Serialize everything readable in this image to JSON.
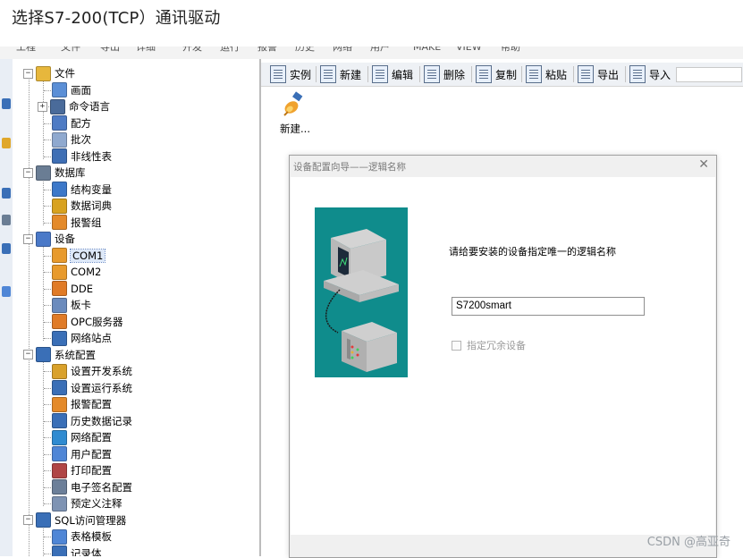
{
  "heading": "选择S7-200(TCP）通讯驱动",
  "menubar": {
    "items": [
      "工程",
      "文件",
      "导出",
      "详细",
      "开发",
      "运行",
      "报警",
      "历史",
      "网络",
      "用户",
      "MAKE",
      "VIEW",
      "帮助"
    ]
  },
  "tree": {
    "items": [
      {
        "label": "文件",
        "level": 0,
        "expander": "−",
        "icon": "folder-icon",
        "color": "#e7b73c"
      },
      {
        "label": "画面",
        "level": 1,
        "icon": "screen-icon",
        "color": "#5b8fd6"
      },
      {
        "label": "命令语言",
        "level": 1,
        "expander": "+",
        "icon": "command-icon",
        "color": "#4a6b9a"
      },
      {
        "label": "配方",
        "level": 1,
        "icon": "recipe-icon",
        "color": "#4e7bc4"
      },
      {
        "label": "批次",
        "level": 1,
        "icon": "batch-icon",
        "color": "#8fa9cf"
      },
      {
        "label": "非线性表",
        "level": 1,
        "icon": "nonlinear-table-icon",
        "color": "#3f6fb5"
      },
      {
        "label": "数据库",
        "level": 0,
        "expander": "−",
        "icon": "database-icon",
        "color": "#6a7d94"
      },
      {
        "label": "结构变量",
        "level": 1,
        "icon": "struct-variable-icon",
        "color": "#3c78c9"
      },
      {
        "label": "数据词典",
        "level": 1,
        "icon": "data-dictionary-icon",
        "color": "#d8a21f"
      },
      {
        "label": "报警组",
        "level": 1,
        "icon": "alarm-group-icon",
        "color": "#e48a2a"
      },
      {
        "label": "设备",
        "level": 0,
        "expander": "−",
        "icon": "device-icon",
        "color": "#4a79c8"
      },
      {
        "label": "COM1",
        "level": 1,
        "icon": "com-port-icon",
        "color": "#e89a2c",
        "selected": true
      },
      {
        "label": "COM2",
        "level": 1,
        "icon": "com-port-icon",
        "color": "#e89a2c"
      },
      {
        "label": "DDE",
        "level": 1,
        "icon": "dde-icon",
        "color": "#e07b27"
      },
      {
        "label": "板卡",
        "level": 1,
        "icon": "board-card-icon",
        "color": "#6b8bbd"
      },
      {
        "label": "OPC服务器",
        "level": 1,
        "icon": "opc-server-icon",
        "color": "#e07b27"
      },
      {
        "label": "网络站点",
        "level": 1,
        "icon": "network-node-icon",
        "color": "#3a6fb7"
      },
      {
        "label": "系统配置",
        "level": 0,
        "expander": "−",
        "icon": "system-config-icon",
        "color": "#3a6fb7"
      },
      {
        "label": "设置开发系统",
        "level": 1,
        "icon": "dev-system-icon",
        "color": "#d9a12b"
      },
      {
        "label": "设置运行系统",
        "level": 1,
        "icon": "run-system-icon",
        "color": "#3a6fb7"
      },
      {
        "label": "报警配置",
        "level": 1,
        "icon": "alarm-config-icon",
        "color": "#e48a2a"
      },
      {
        "label": "历史数据记录",
        "level": 1,
        "icon": "history-record-icon",
        "color": "#3a6fb7"
      },
      {
        "label": "网络配置",
        "level": 1,
        "icon": "network-config-icon",
        "color": "#2f8bd1"
      },
      {
        "label": "用户配置",
        "level": 1,
        "icon": "user-config-icon",
        "color": "#4f86d6"
      },
      {
        "label": "打印配置",
        "level": 1,
        "icon": "print-config-icon",
        "color": "#b04545"
      },
      {
        "label": "电子签名配置",
        "level": 1,
        "icon": "e-signature-icon",
        "color": "#6c7f99"
      },
      {
        "label": "预定义注释",
        "level": 1,
        "icon": "predefined-note-icon",
        "color": "#7e93b3"
      },
      {
        "label": "SQL访问管理器",
        "level": 0,
        "expander": "−",
        "icon": "sql-manager-icon",
        "color": "#3a6fb7"
      },
      {
        "label": "表格模板",
        "level": 1,
        "icon": "table-template-icon",
        "color": "#4f86d6"
      },
      {
        "label": "记录体",
        "level": 1,
        "icon": "record-icon",
        "color": "#3a6fb7"
      }
    ]
  },
  "toolbar": {
    "buttons": [
      {
        "label": "实例",
        "icon": "instance-icon"
      },
      {
        "label": "新建",
        "icon": "new-icon"
      },
      {
        "label": "编辑",
        "icon": "edit-icon"
      },
      {
        "label": "删除",
        "icon": "delete-icon"
      },
      {
        "label": "复制",
        "icon": "copy-icon"
      },
      {
        "label": "粘贴",
        "icon": "paste-icon"
      },
      {
        "label": "导出",
        "icon": "export-icon"
      },
      {
        "label": "导入",
        "icon": "import-icon"
      }
    ]
  },
  "content": {
    "new_item_label": "新建..."
  },
  "dialog": {
    "title": "设备配置向导——逻辑名称",
    "close_glyph": "✕",
    "prompt": "请给要安装的设备指定唯一的逻辑名称",
    "logical_name_value": "S7200smart",
    "checkbox_label": "指定冗余设备",
    "art_color": "#0f8c8c"
  },
  "watermark": "CSDN @高亚奇"
}
